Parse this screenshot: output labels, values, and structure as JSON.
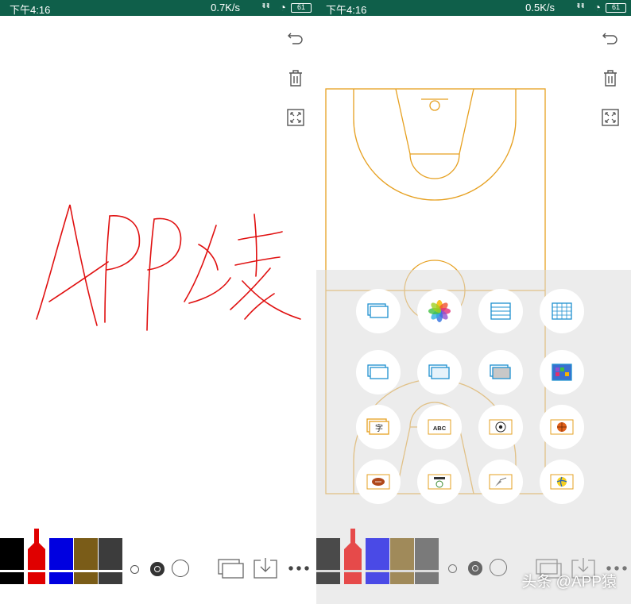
{
  "left": {
    "status": {
      "time": "下午4:16",
      "speed": "0.7K/s",
      "battery": "61"
    },
    "drawing_text": "APP猿"
  },
  "right": {
    "status": {
      "time": "下午4:16",
      "speed": "0.5K/s",
      "battery": "61"
    },
    "options": [
      [
        "layers",
        "photos",
        "stack",
        "grid"
      ],
      [
        "layers-2",
        "layers-3",
        "gray-card",
        "pixel-grid"
      ],
      [
        "zi-card",
        "abc-card",
        "soccer-card",
        "basketball-card"
      ],
      [
        "football-card",
        "english-card",
        "badminton-card",
        "volleyball-card"
      ]
    ],
    "zi_label": "字",
    "abc_label": "ABC"
  },
  "pens": [
    "#000000",
    "#e00000",
    "#0000e0",
    "#7a5c18",
    "#3c3c3c"
  ],
  "watermark": "头条 @APP猿"
}
